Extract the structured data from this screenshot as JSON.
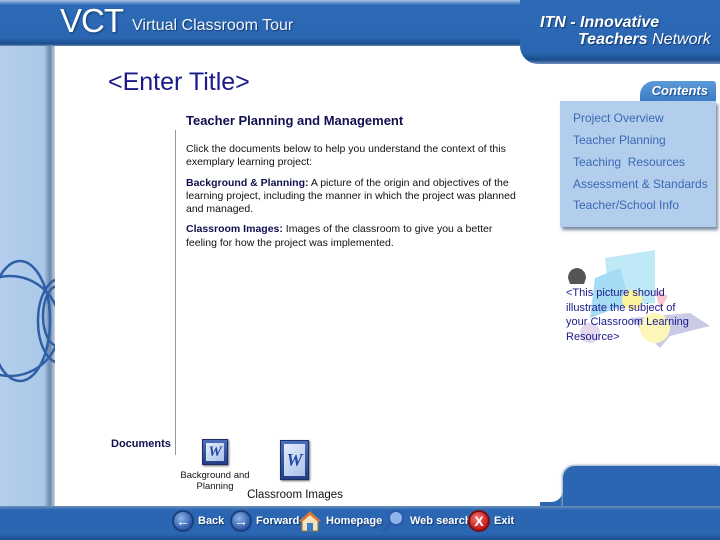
{
  "header": {
    "logo": "VCT",
    "app_title": "Virtual Classroom Tour",
    "org_line1": "ITN - Innovative",
    "org_line2_bold": "Teachers",
    "org_line2_rest": " Network"
  },
  "page": {
    "title": "<Enter Title>",
    "section_title": "Teacher Planning and Management",
    "intro": "Click the documents below to help you understand the context of this exemplary learning project:",
    "items": [
      {
        "label": "Background & Planning:",
        "text": " A picture of the origin and objectives of the learning project, including the manner in which the project was planned and managed."
      },
      {
        "label": "Classroom Images:",
        "text": " Images of the classroom to give you a better feeling for how the project was implemented."
      }
    ]
  },
  "contents": {
    "heading": "Contents",
    "items": [
      {
        "label": "Project Overview"
      },
      {
        "label": "Teacher Planning"
      },
      {
        "label": "Teaching  Resources"
      },
      {
        "label": "Assessment & Standards"
      },
      {
        "label": "Teacher/School Info"
      }
    ]
  },
  "illustration": {
    "placeholder_text": "<This picture should illustrate the subject of your Classroom Learning Resource>"
  },
  "documents": {
    "label": "Documents",
    "files": [
      {
        "caption": "Background and Planning",
        "icon": "word-document-icon",
        "glyph": "W"
      },
      {
        "caption": "Classroom Images",
        "icon": "word-document-icon",
        "glyph": "W"
      }
    ]
  },
  "nav": {
    "back": "Back",
    "forward": "Forward",
    "homepage": "Homepage",
    "web_search": "Web search",
    "exit": "Exit"
  },
  "colors": {
    "brand_blue": "#2a66b2",
    "title_navy": "#1a1a8c",
    "contents_bg": "#b3cdec",
    "contents_text": "#3a6ab4"
  }
}
